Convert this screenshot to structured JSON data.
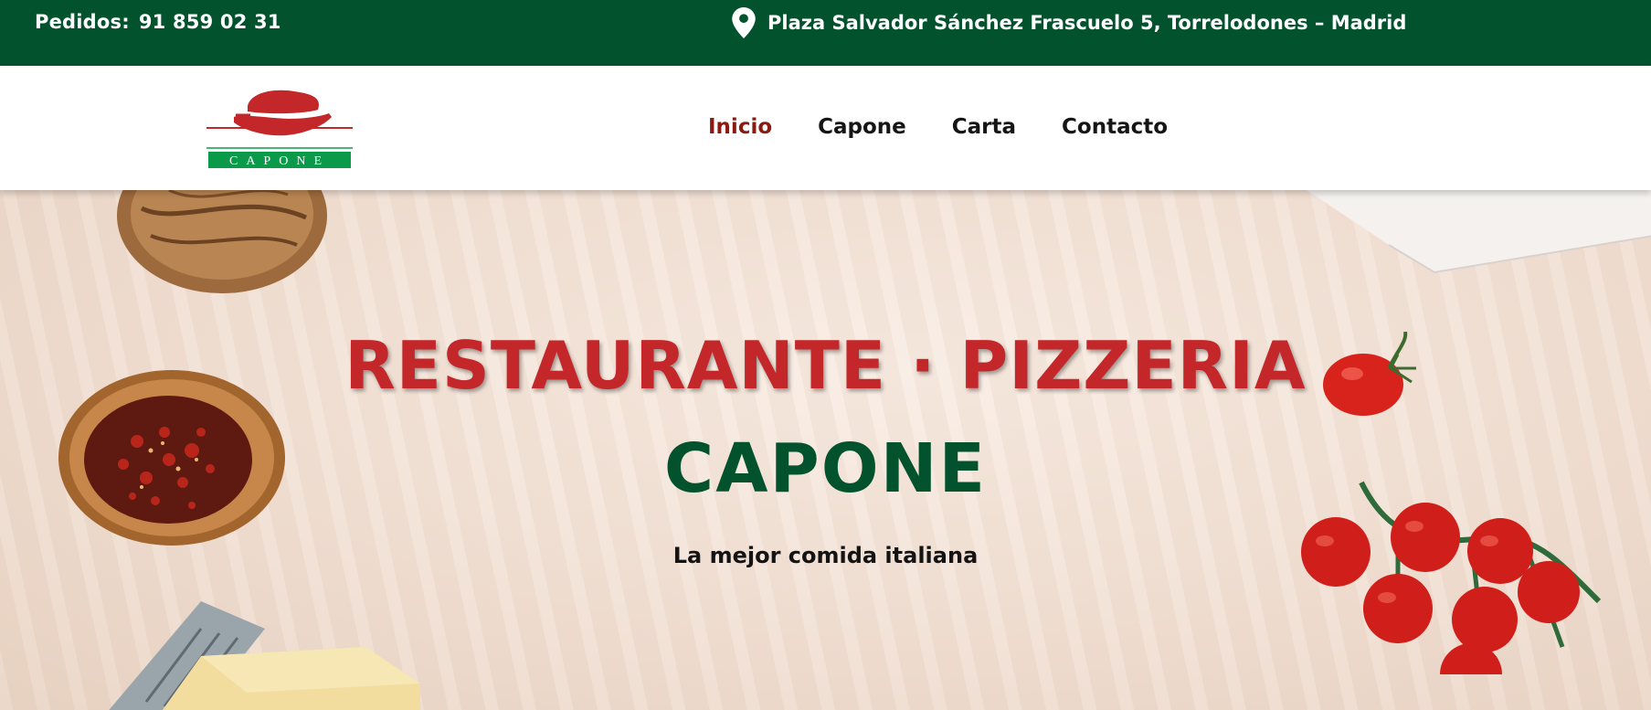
{
  "topbar": {
    "orders_label": "Pedidos:",
    "orders_phone": "91 859 02 31",
    "address": "Plaza Salvador Sánchez Frascuelo 5, Torrelodones – Madrid",
    "address_icon": "map-pin-icon"
  },
  "logo": {
    "text": "CAPONE",
    "colors": {
      "red": "#c4272a",
      "green": "#0a9a4a"
    }
  },
  "nav": {
    "items": [
      {
        "label": "Inicio",
        "active": true
      },
      {
        "label": "Capone",
        "active": false
      },
      {
        "label": "Carta",
        "active": false
      },
      {
        "label": "Contacto",
        "active": false
      }
    ]
  },
  "hero": {
    "title": "RESTAURANTE · PIZZERIA",
    "subtitle": "CAPONE",
    "tagline": "La mejor comida italiana"
  },
  "colors": {
    "brand_green": "#02522e",
    "brand_red": "#c4272a",
    "nav_active": "#8b1a10"
  }
}
